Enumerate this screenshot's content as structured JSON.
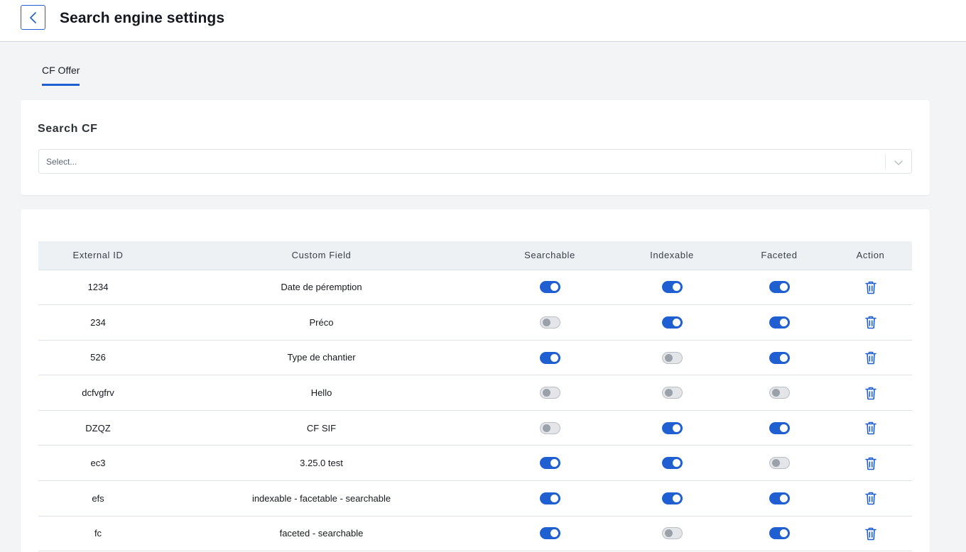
{
  "header": {
    "title": "Search engine settings"
  },
  "tabs": [
    {
      "label": "CF Offer"
    }
  ],
  "search": {
    "label": "Search CF",
    "placeholder": "Select..."
  },
  "colors": {
    "accent": "#1f5fd1",
    "toggle_off": "#e3e5e8"
  },
  "table": {
    "columns": [
      "External ID",
      "Custom Field",
      "Searchable",
      "Indexable",
      "Faceted",
      "Action"
    ],
    "rows": [
      {
        "external_id": "1234",
        "custom_field": "Date de péremption",
        "searchable": true,
        "indexable": true,
        "faceted": true
      },
      {
        "external_id": "234",
        "custom_field": "Préco",
        "searchable": false,
        "indexable": true,
        "faceted": true
      },
      {
        "external_id": "526",
        "custom_field": "Type de chantier",
        "searchable": true,
        "indexable": false,
        "faceted": true
      },
      {
        "external_id": "dcfvgfrv",
        "custom_field": "Hello",
        "searchable": false,
        "indexable": false,
        "faceted": false
      },
      {
        "external_id": "DZQZ",
        "custom_field": "CF SIF",
        "searchable": false,
        "indexable": true,
        "faceted": true
      },
      {
        "external_id": "ec3",
        "custom_field": "3.25.0 test",
        "searchable": true,
        "indexable": true,
        "faceted": false
      },
      {
        "external_id": "efs",
        "custom_field": "indexable - facetable - searchable",
        "searchable": true,
        "indexable": true,
        "faceted": true
      },
      {
        "external_id": "fc",
        "custom_field": "faceted - searchable",
        "searchable": true,
        "indexable": false,
        "faceted": true
      }
    ]
  },
  "icons": {
    "back": "chevron-left-icon",
    "select": "chevron-down-icon",
    "delete": "trash-icon"
  }
}
